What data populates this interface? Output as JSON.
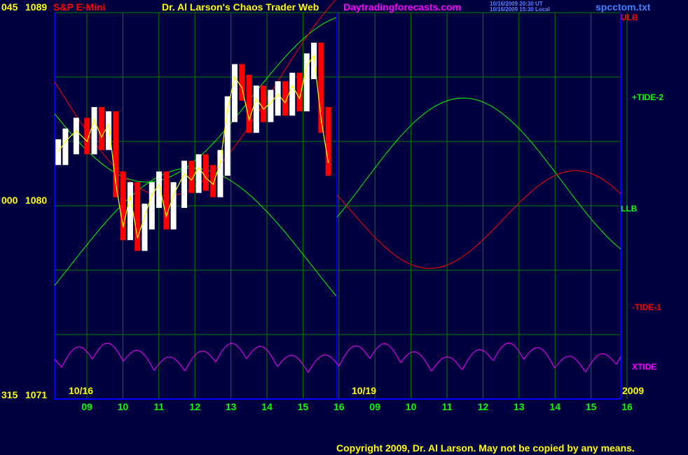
{
  "header": {
    "index_label": "045",
    "price_top": "1089",
    "instrument": "S&P E-Mini",
    "title": "Dr. Al Larson's Chaos Trader Web",
    "site": "Daytradingforecasts.com",
    "timestamp_ut": "10/16/2009 20:30 UT",
    "timestamp_local": "10/16/2009 15:30 Local",
    "file": "spcctom.txt"
  },
  "left_labels": {
    "mid_index": "000",
    "mid_price": "1080",
    "bottom_index": "315",
    "bottom_price": "1071"
  },
  "date_labels": {
    "left": "10/16",
    "center": "10/19",
    "year": "2009"
  },
  "x_ticks": [
    "09",
    "10",
    "11",
    "12",
    "13",
    "14",
    "15",
    "16",
    "09",
    "10",
    "11",
    "12",
    "13",
    "14",
    "15",
    "16"
  ],
  "right_labels": [
    "ULB",
    "+TIDE-2",
    "LLB",
    "-TIDE-1",
    "XTIDE"
  ],
  "copyright": "Copyright 2009, Dr. Al Larson. May not be copied by any means.",
  "colors": {
    "background": "#000040",
    "grid": "#008000",
    "axis": "#0000ff",
    "price_up": "#ffffff",
    "price_down": "#ff0000",
    "moving_average": "#ffff00",
    "tide_plus": "#00ff00",
    "tide_minus": "#ff0000",
    "xtide": "#ff00ff",
    "tick_labels": "#00ff00",
    "divider": "#0000ff",
    "title": "#ffff00",
    "instrument": "#ff0000",
    "site": "#ff00ff",
    "file": "#4080ff"
  },
  "chart_data": {
    "type": "line",
    "title": "S&P E-Mini",
    "ylim": [
      1071,
      1089
    ],
    "y_ticks": [
      1071,
      1080,
      1089
    ],
    "x_hours": [
      9,
      10,
      11,
      12,
      13,
      14,
      15,
      16,
      9,
      10,
      11,
      12,
      13,
      14,
      15,
      16
    ],
    "series": [
      {
        "name": "S&P E-Mini (price)",
        "x": [
          8.5,
          8.7,
          9.0,
          9.3,
          9.5,
          9.7,
          9.9,
          10.1,
          10.3,
          10.5,
          10.7,
          10.9,
          11.1,
          11.3,
          11.5,
          11.7,
          12.0,
          12.2,
          12.4,
          12.6,
          12.8,
          13.0,
          13.2,
          13.4,
          13.6,
          13.8,
          14.0,
          14.2,
          14.4,
          14.6,
          14.8,
          15.0,
          15.2,
          15.4,
          15.6,
          15.8,
          16.0
        ],
        "values": [
          1082.5,
          1083.0,
          1083.5,
          1083.0,
          1084.0,
          1083.2,
          1083.8,
          1081.0,
          1079.0,
          1080.5,
          1078.5,
          1079.5,
          1080.5,
          1081.0,
          1079.5,
          1080.5,
          1081.5,
          1081.2,
          1081.8,
          1081.3,
          1081.0,
          1082.0,
          1084.5,
          1086.0,
          1085.5,
          1084.0,
          1085.0,
          1084.5,
          1084.8,
          1085.2,
          1084.8,
          1085.6,
          1085.0,
          1086.5,
          1087.0,
          1084.0,
          1082.0
        ]
      },
      {
        "name": "ULB",
        "x": [
          8.5,
          9.0,
          9.5,
          10.0,
          10.5,
          11.0,
          11.5,
          12.0,
          12.5,
          13.0,
          13.5,
          14.0,
          14.5,
          15.0,
          15.5,
          16.0
        ],
        "values": [
          1085.0,
          1084.0,
          1082.0,
          1080.0,
          1078.0,
          1077.5,
          1080.0,
          1085.5,
          1087.0,
          1086.0,
          1084.0,
          1082.5,
          1081.5,
          1082.0,
          1081.5,
          1080.5
        ]
      }
    ]
  }
}
